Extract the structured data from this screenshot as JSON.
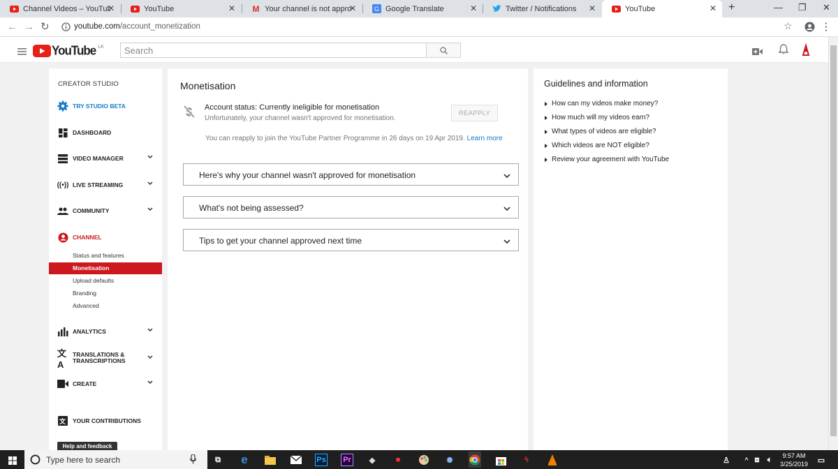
{
  "browser": {
    "tabs": [
      {
        "title": "Channel Videos – YouTube Stu",
        "icon": "youtube-icon"
      },
      {
        "title": "YouTube",
        "icon": "youtube-icon"
      },
      {
        "title": "Your channel is not approved f",
        "icon": "gmail-icon"
      },
      {
        "title": "Google Translate",
        "icon": "google-translate-icon"
      },
      {
        "title": "Twitter / Notifications",
        "icon": "twitter-icon"
      },
      {
        "title": "YouTube",
        "icon": "youtube-icon"
      }
    ],
    "new_tab": "+",
    "url_host": "youtube.com",
    "url_path": "/account_monetization"
  },
  "masthead": {
    "logo_text": "YouTube",
    "country": "LK",
    "search_placeholder": "Search"
  },
  "sidebar": {
    "header": "CREATOR STUDIO",
    "items": [
      {
        "label": "TRY STUDIO BETA"
      },
      {
        "label": "DASHBOARD"
      },
      {
        "label": "VIDEO MANAGER"
      },
      {
        "label": "LIVE STREAMING"
      },
      {
        "label": "COMMUNITY"
      },
      {
        "label": "CHANNEL"
      },
      {
        "label": "ANALYTICS"
      },
      {
        "label": "TRANSLATIONS &"
      },
      {
        "label": "CREATE"
      },
      {
        "label": "YOUR CONTRIBUTIONS"
      }
    ],
    "translations_line2": "TRANSCRIPTIONS",
    "channel_subitems": [
      "Status and features",
      "Monetisation",
      "Upload defaults",
      "Branding",
      "Advanced"
    ],
    "help_button": "Help and feedback"
  },
  "main": {
    "title": "Monetisation",
    "status_title": "Account status: Currently ineligible for monetisation",
    "status_sub": "Unfortunately, your channel wasn't approved for monetisation.",
    "reapply_button": "REAPPLY",
    "reapply_note": "You can reapply to join the YouTube Partner Programme in 26 days on 19 Apr 2019.",
    "learn_more": "Learn more",
    "accordions": [
      "Here's why your channel wasn't approved for monetisation",
      "What's not being assessed?",
      "Tips to get your channel approved next time"
    ]
  },
  "guide": {
    "title": "Guidelines and information",
    "links": [
      "How can my videos make money?",
      "How much will my videos earn?",
      "What types of videos are eligible?",
      "Which videos are NOT eligible?",
      "Review your agreement with YouTube"
    ]
  },
  "taskbar": {
    "search_placeholder": "Type here to search",
    "time": "9:57 AM",
    "date": "3/25/2019"
  },
  "colors": {
    "accent": "#cc181e",
    "link": "#167ac6"
  }
}
